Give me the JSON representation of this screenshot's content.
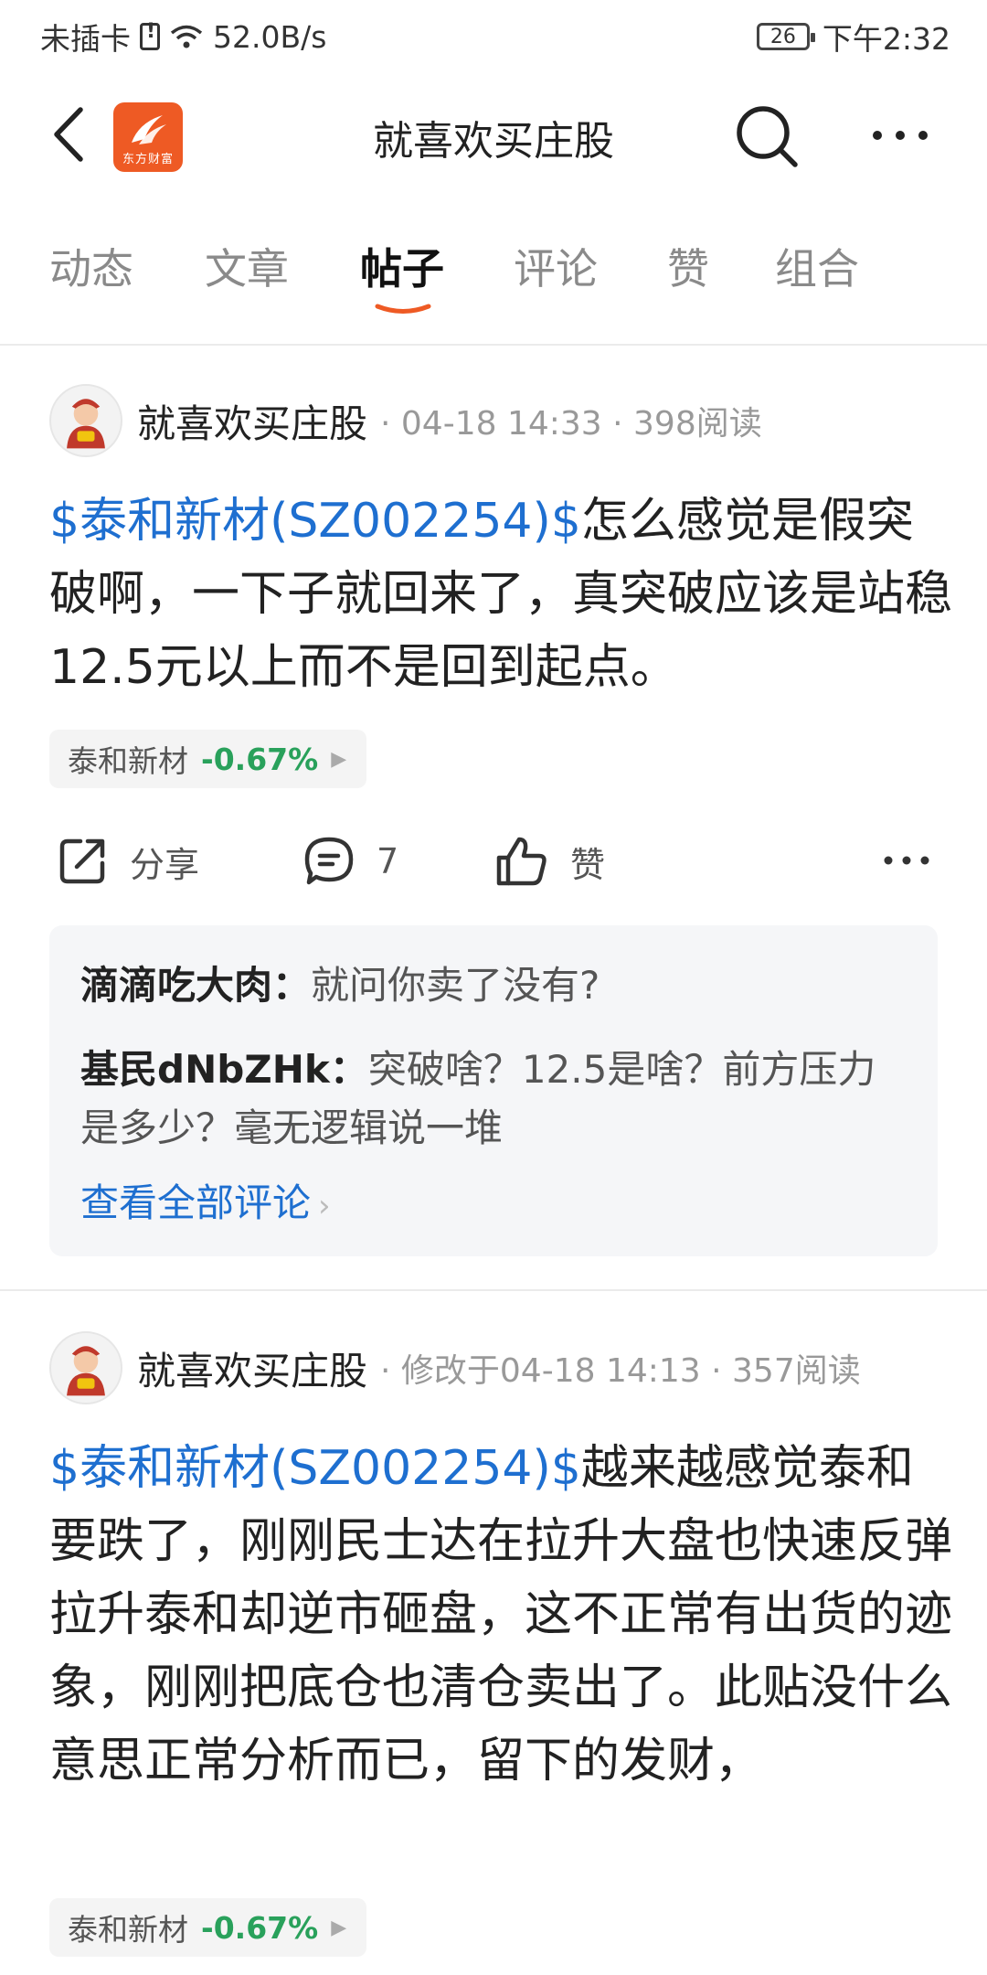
{
  "status_bar": {
    "carrier": "未插卡",
    "speed": "52.0B/s",
    "battery": "26",
    "time": "下午2:32"
  },
  "header": {
    "title": "就喜欢买庄股",
    "logo_text": "东方财富"
  },
  "tabs": [
    {
      "label": "动态"
    },
    {
      "label": "文章"
    },
    {
      "label": "帖子"
    },
    {
      "label": "评论"
    },
    {
      "label": "赞"
    },
    {
      "label": "组合"
    }
  ],
  "active_tab": "帖子",
  "colors": {
    "accent": "#ee5a24",
    "link": "#1e6fd0",
    "positive_change": "#29a15b"
  },
  "posts": [
    {
      "author": "就喜欢买庄股",
      "meta": "· 04-18 14:33 · 398阅读",
      "stock_link": "$泰和新材(SZ002254)$",
      "text": "怎么感觉是假突破啊，一下子就回来了，真突破应该是站稳12.5元以上而不是回到起点。",
      "tag": {
        "name": "泰和新材",
        "change": "-0.67%"
      },
      "actions": {
        "share": "分享",
        "comments": "7",
        "like": "赞"
      },
      "comments": [
        {
          "name": "滴滴吃大肉：",
          "text": "就问你卖了没有?"
        },
        {
          "name": "基民dNbZHk：",
          "text": "突破啥？12.5是啥？前方压力是多少？毫无逻辑说一堆"
        }
      ],
      "view_all": "查看全部评论"
    },
    {
      "author": "就喜欢买庄股",
      "meta": "· 修改于04-18 14:13 · 357阅读",
      "stock_link": "$泰和新材(SZ002254)$",
      "text": "越来越感觉泰和要跌了，刚刚民士达在拉升大盘也快速反弹拉升泰和却逆市砸盘，这不正常有出货的迹象，刚刚把底仓也清仓卖出了。此贴没什么意思正常分析而已，留下的发财，",
      "tag": {
        "name": "泰和新材",
        "change": "-0.67%"
      }
    }
  ]
}
